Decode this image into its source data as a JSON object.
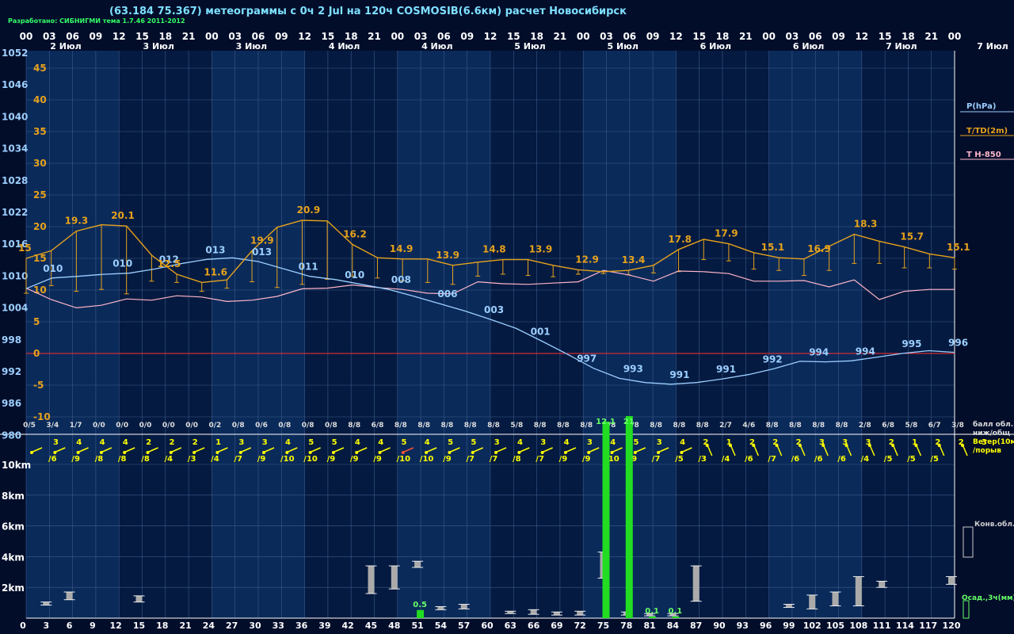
{
  "header": {
    "title": "(63.184 75.367) метеограммы с  0ч 2 Jul на 120ч COSMOSIB(6.6км) расчет Новосибирск",
    "credit": "Разработано: СИБНИГМИ тема 1.7.46 2011-2012"
  },
  "colors": {
    "background": "#020d2a",
    "band_light": "#0a2a5a",
    "band_dark": "#041a40",
    "grid": "#3c5a8a",
    "pressure": "#9ccfff",
    "temperature": "#e6a21c",
    "t850": "#ffb6c8",
    "zero_line": "#ff3030",
    "wind": "#ffff00",
    "precip": "#22dd22",
    "cloud_bar": "#aaaaaa"
  },
  "chart_data": {
    "type": "line",
    "top_hours": [
      "00",
      "03",
      "06",
      "09",
      "12",
      "15",
      "18",
      "21",
      "00",
      "03",
      "06",
      "09",
      "12",
      "15",
      "18",
      "21",
      "00",
      "03",
      "06",
      "09",
      "12",
      "15",
      "18",
      "21",
      "00",
      "03",
      "06",
      "09",
      "12",
      "15",
      "18",
      "21",
      "00",
      "03",
      "06",
      "09",
      "12",
      "15",
      "18",
      "21",
      "00"
    ],
    "day_labels": [
      "2 Июл",
      "3 Июл",
      "3 Июл",
      "4 Июл",
      "4 Июл",
      "5 Июл",
      "5 Июл",
      "6 Июл",
      "6 Июл",
      "7 Июл",
      "7 Июл"
    ],
    "pressure_axis_labels": [
      "1052",
      "1046",
      "1040",
      "1034",
      "1028",
      "1022",
      "1016",
      "1010",
      "1004",
      "998",
      "992",
      "986",
      "980"
    ],
    "temperature_axis_labels": [
      "45",
      "40",
      "35",
      "30",
      "25",
      "20",
      "15",
      "10",
      "5",
      "0",
      "-5",
      "-10"
    ],
    "pressure": {
      "name": "P(hPa)",
      "values": [
        1007.5,
        1009.5,
        1009.8,
        1010.2,
        1010.4,
        1011.2,
        1012.2,
        1013.0,
        1013.3,
        1012.6,
        1011.2,
        1009.8,
        1009.2,
        1008.3,
        1007.4,
        1006.1,
        1004.7,
        1003.3,
        1001.7,
        1000.0,
        997.6,
        995.1,
        992.5,
        990.6,
        989.8,
        989.5,
        989.8,
        990.5,
        991.3,
        992.4,
        993.8,
        993.7,
        993.9,
        994.6,
        995.3,
        995.8,
        995.5
      ],
      "labels": [
        {
          "i": 1,
          "text": "010"
        },
        {
          "i": 4,
          "text": "010"
        },
        {
          "i": 6,
          "text": "012"
        },
        {
          "i": 8,
          "text": "013"
        },
        {
          "i": 10,
          "text": "013"
        },
        {
          "i": 12,
          "text": "011"
        },
        {
          "i": 14,
          "text": "010"
        },
        {
          "i": 16,
          "text": "008"
        },
        {
          "i": 18,
          "text": "006"
        },
        {
          "i": 20,
          "text": "003"
        },
        {
          "i": 22,
          "text": "001"
        },
        {
          "i": 24,
          "text": "997"
        },
        {
          "i": 26,
          "text": "993"
        },
        {
          "i": 28,
          "text": "991"
        },
        {
          "i": 30,
          "text": "991"
        },
        {
          "i": 32,
          "text": "992"
        },
        {
          "i": 34,
          "text": "994"
        },
        {
          "i": 36,
          "text": "994"
        },
        {
          "i": 38,
          "text": "995"
        },
        {
          "i": 40,
          "text": "996"
        }
      ]
    },
    "temperature": {
      "name": "T/TD(2m)",
      "values": [
        15.0,
        16.2,
        19.3,
        20.3,
        20.1,
        15.5,
        12.5,
        11.2,
        11.6,
        16.2,
        19.9,
        21.0,
        20.9,
        17.2,
        15.1,
        14.9,
        14.9,
        13.9,
        14.4,
        14.8,
        14.8,
        13.9,
        13.2,
        12.9,
        13.1,
        13.9,
        16.4,
        18.0,
        17.3,
        15.9,
        15.1,
        14.9,
        16.9,
        18.8,
        17.7,
        16.8,
        15.7,
        15.1
      ],
      "dew": [
        9.5,
        10.7,
        9.8,
        10.1,
        9.4,
        11.4,
        11.2,
        9.8,
        10.3,
        11.3,
        10.4,
        10.9,
        11.7,
        12.2,
        11.9,
        11.5,
        11.2,
        10.9,
        12.2,
        12.5,
        12.3,
        12.1,
        12.5,
        12.6,
        12.4,
        12.7,
        12.9,
        14.8,
        14.6,
        13.3,
        13.1,
        12.3,
        13.1,
        14.2,
        14.2,
        13.5,
        13.5,
        13.3
      ],
      "labels": [
        {
          "i": 0,
          "text": "15"
        },
        {
          "i": 2,
          "text": "19.3"
        },
        {
          "i": 4,
          "text": "20.1"
        },
        {
          "i": 6,
          "text": "12.5"
        },
        {
          "i": 8,
          "text": "11.6"
        },
        {
          "i": 10,
          "text": "19.9"
        },
        {
          "i": 12,
          "text": "20.9"
        },
        {
          "i": 14,
          "text": "16.2"
        },
        {
          "i": 16,
          "text": "14.9"
        },
        {
          "i": 18,
          "text": "13.9"
        },
        {
          "i": 20,
          "text": "14.8"
        },
        {
          "i": 22,
          "text": "13.9"
        },
        {
          "i": 24,
          "text": "12.9"
        },
        {
          "i": 26,
          "text": "13.4"
        },
        {
          "i": 28,
          "text": "17.8"
        },
        {
          "i": 30,
          "text": "17.9"
        },
        {
          "i": 32,
          "text": "15.1"
        },
        {
          "i": 34,
          "text": "16.9"
        },
        {
          "i": 36,
          "text": "18.3"
        },
        {
          "i": 38,
          "text": "15.7"
        },
        {
          "i": 40,
          "text": "15.1"
        }
      ]
    },
    "t850": {
      "name": "T H-850",
      "values": [
        10.3,
        8.5,
        7.2,
        7.6,
        8.6,
        8.4,
        9.1,
        8.9,
        8.2,
        8.4,
        9.0,
        10.2,
        10.3,
        10.8,
        10.4,
        10.1,
        9.5,
        9.4,
        11.3,
        11.0,
        10.9,
        11.1,
        11.3,
        13.1,
        12.4,
        11.4,
        13.0,
        12.9,
        12.6,
        11.4,
        11.4,
        11.5,
        10.5,
        11.6,
        8.5,
        9.8,
        10.1,
        10.1
      ]
    },
    "cloud_codes": [
      "0/5",
      "3/4",
      "1/7",
      "0/0",
      "0/0",
      "0/0",
      "0/0",
      "0/0",
      "0/2",
      "0/8",
      "0/6",
      "0/8",
      "0/8",
      "0/8",
      "8/8",
      "6/8",
      "8/8",
      "8/8",
      "8/8",
      "8/8",
      "8/8",
      "5/8",
      "8/8",
      "8/8",
      "8/8",
      "8/8",
      "8/8",
      "8/8",
      "8/8",
      "8/8",
      "2/7",
      "4/6",
      "8/8",
      "8/8",
      "8/8",
      "8/8",
      "2/8",
      "6/8",
      "5/8",
      "6/7",
      "3/8"
    ],
    "cloud_legend": "балл обл. ниж/общ",
    "wind_speed": [
      "3",
      "4",
      "4",
      "4",
      "2",
      "2",
      "2",
      "1",
      "3",
      "3",
      "4",
      "5",
      "5",
      "4",
      "4",
      "5",
      "4",
      "5",
      "5",
      "3",
      "4",
      "3",
      "4",
      "3",
      "4",
      "5",
      "3",
      "4",
      "2",
      "1",
      "2",
      "2",
      "2",
      "3",
      "3",
      "3",
      "2",
      "1",
      "2",
      "2",
      "3"
    ],
    "wind_gust": [
      "/6",
      "/9",
      "/8",
      "/8",
      "/8",
      "/4",
      "/3",
      "/4",
      "/7",
      "/9",
      "/10",
      "/10",
      "/9",
      "/9",
      "/9",
      "/10",
      "/10",
      "/9",
      "/7",
      "/7",
      "/8",
      "/7",
      "/9",
      "/9",
      "/10",
      "/9",
      "/7",
      "/5",
      "/3",
      "/4",
      "/6",
      "/7",
      "/6",
      "/6",
      "/6",
      "/4",
      "/5",
      "/5",
      "/5"
    ],
    "wind_legend": "Ветер(10м) /порыв",
    "bottom_axis_labels": [
      "2km",
      "4km",
      "6km",
      "8km",
      "10km"
    ],
    "bottom_hours": [
      "0",
      "3",
      "6",
      "9",
      "12",
      "15",
      "18",
      "21",
      "24",
      "27",
      "30",
      "33",
      "36",
      "39",
      "42",
      "45",
      "48",
      "51",
      "54",
      "57",
      "60",
      "63",
      "66",
      "69",
      "72",
      "75",
      "78",
      "81",
      "84",
      "87",
      "90",
      "93",
      "96",
      "99",
      "102",
      "105",
      "108",
      "111",
      "114",
      "117",
      "120"
    ],
    "precip": {
      "name": "Осад.,3ч(мм)",
      "values": [
        {
          "i": 17,
          "v": 0.5,
          "label": "0.5"
        },
        {
          "i": 25,
          "v": 12.1,
          "label": "12.1"
        },
        {
          "i": 26,
          "v": 21.0,
          "label": "21"
        },
        {
          "i": 27,
          "v": 0.1,
          "label": "0.1"
        },
        {
          "i": 28,
          "v": 0.1,
          "label": "0.1"
        }
      ]
    },
    "conv_cloud": {
      "name": "Конв.обл.",
      "bars": [
        {
          "i": 1,
          "lo": 0.85,
          "hi": 1.05
        },
        {
          "i": 2,
          "lo": 1.2,
          "hi": 1.7
        },
        {
          "i": 5,
          "lo": 1.05,
          "hi": 1.45
        },
        {
          "i": 15,
          "lo": 1.6,
          "hi": 3.4
        },
        {
          "i": 16,
          "lo": 1.9,
          "hi": 3.4
        },
        {
          "i": 17,
          "lo": 3.3,
          "hi": 3.7
        },
        {
          "i": 18,
          "lo": 0.55,
          "hi": 0.75
        },
        {
          "i": 19,
          "lo": 0.6,
          "hi": 0.9
        },
        {
          "i": 21,
          "lo": 0.3,
          "hi": 0.45
        },
        {
          "i": 22,
          "lo": 0.25,
          "hi": 0.55
        },
        {
          "i": 23,
          "lo": 0.2,
          "hi": 0.4
        },
        {
          "i": 24,
          "lo": 0.2,
          "hi": 0.45
        },
        {
          "i": 25,
          "lo": 2.6,
          "hi": 4.3
        },
        {
          "i": 26,
          "lo": 0.2,
          "hi": 0.4
        },
        {
          "i": 27,
          "lo": 0.15,
          "hi": 0.3
        },
        {
          "i": 28,
          "lo": 0.15,
          "hi": 0.3
        },
        {
          "i": 29,
          "lo": 1.1,
          "hi": 3.4
        },
        {
          "i": 33,
          "lo": 0.7,
          "hi": 0.9
        },
        {
          "i": 34,
          "lo": 0.6,
          "hi": 1.5
        },
        {
          "i": 35,
          "lo": 0.8,
          "hi": 1.7
        },
        {
          "i": 36,
          "lo": 0.8,
          "hi": 2.7
        },
        {
          "i": 37,
          "lo": 2.0,
          "hi": 2.4
        },
        {
          "i": 40,
          "lo": 2.2,
          "hi": 2.7
        }
      ]
    }
  }
}
